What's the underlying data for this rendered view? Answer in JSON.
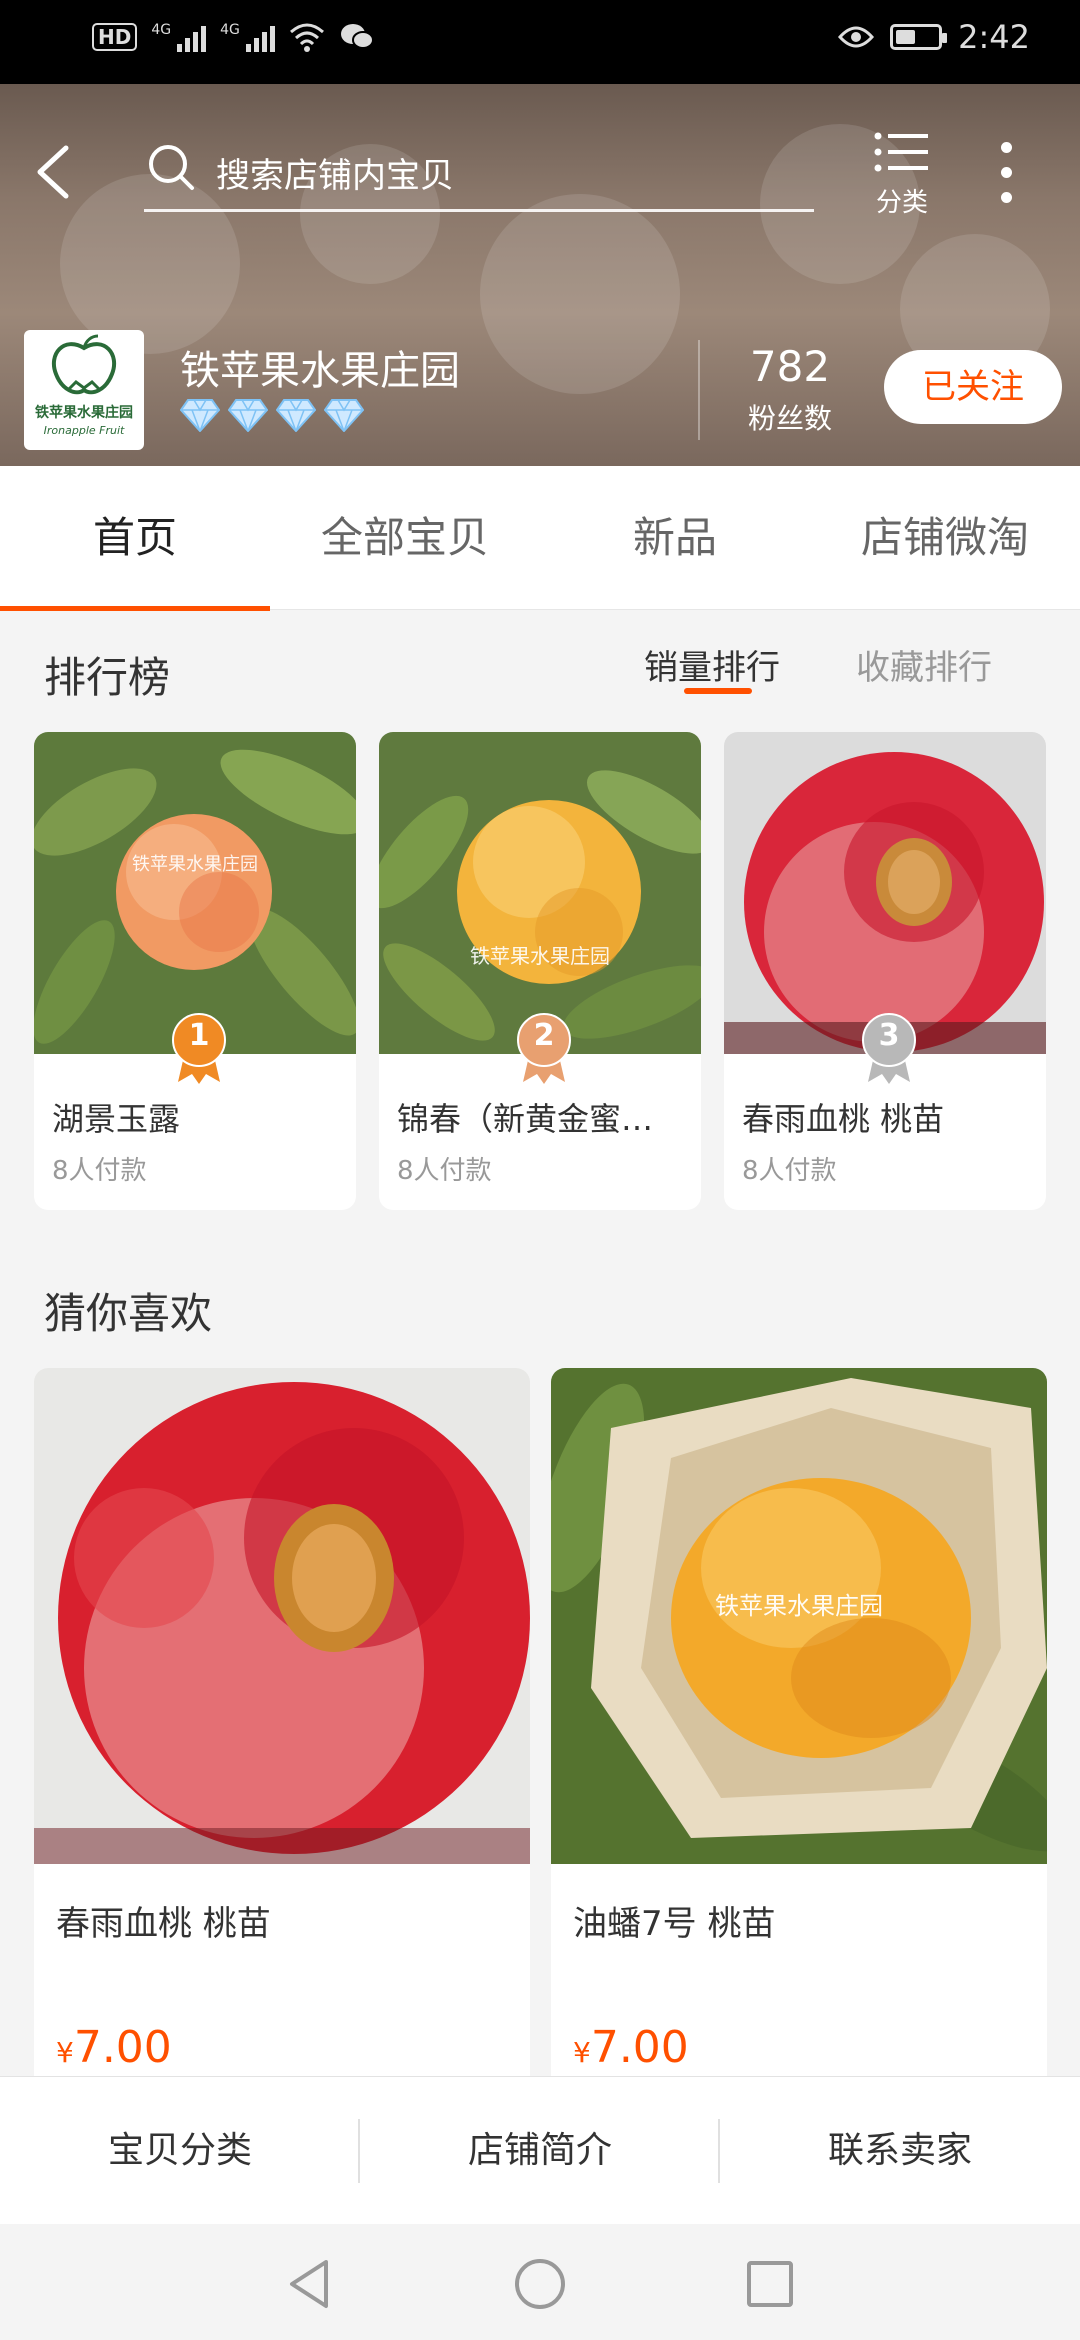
{
  "status_bar": {
    "hd_badge": "HD",
    "network_1": "4G",
    "network_2": "4G",
    "time": "2:42",
    "icons": [
      "hd-icon",
      "signal-icon",
      "signal-icon",
      "wifi-icon",
      "wechat-icon",
      "eye-icon",
      "battery-icon"
    ]
  },
  "header": {
    "search_placeholder": "搜索店铺内宝贝",
    "category_label": "分类",
    "shop_name": "铁苹果水果庄园",
    "logo_text": "铁苹果水果庄园",
    "logo_subtext": "Ironapple Fruit",
    "diamond_count": 4,
    "fans_count": "782",
    "fans_label": "粉丝数",
    "follow_label": "已关注"
  },
  "tabs": [
    {
      "label": "首页",
      "active": true
    },
    {
      "label": "全部宝贝",
      "active": false
    },
    {
      "label": "新品",
      "active": false
    },
    {
      "label": "店铺微淘",
      "active": false
    }
  ],
  "ranking": {
    "title": "排行榜",
    "sort_options": [
      {
        "label": "销量排行",
        "active": true
      },
      {
        "label": "收藏排行",
        "active": false
      }
    ],
    "items": [
      {
        "rank": "1",
        "name": "湖景玉露",
        "sales": "8人付款",
        "watermark": "铁苹果水果庄园",
        "medal_color": "#f08a24"
      },
      {
        "rank": "2",
        "name": "锦春（新黄金蜜…",
        "sales": "8人付款",
        "watermark": "铁苹果水果庄园",
        "medal_color": "#e8a070"
      },
      {
        "rank": "3",
        "name": "春雨血桃 桃苗",
        "sales": "8人付款",
        "watermark": "",
        "medal_color": "#b8b8b8"
      }
    ]
  },
  "recommend": {
    "title": "猜你喜欢",
    "items": [
      {
        "name": "春雨血桃 桃苗",
        "currency": "¥",
        "price": "7.00",
        "watermark": ""
      },
      {
        "name": "油蟠7号 桃苗",
        "currency": "¥",
        "price": "7.00",
        "watermark": "铁苹果水果庄园"
      }
    ]
  },
  "bottom_bar": [
    {
      "label": "宝贝分类"
    },
    {
      "label": "店铺简介"
    },
    {
      "label": "联系卖家"
    }
  ],
  "colors": {
    "accent": "#ff5000",
    "page_bg": "#f4f4f4",
    "status_bar_bg": "#000000"
  }
}
